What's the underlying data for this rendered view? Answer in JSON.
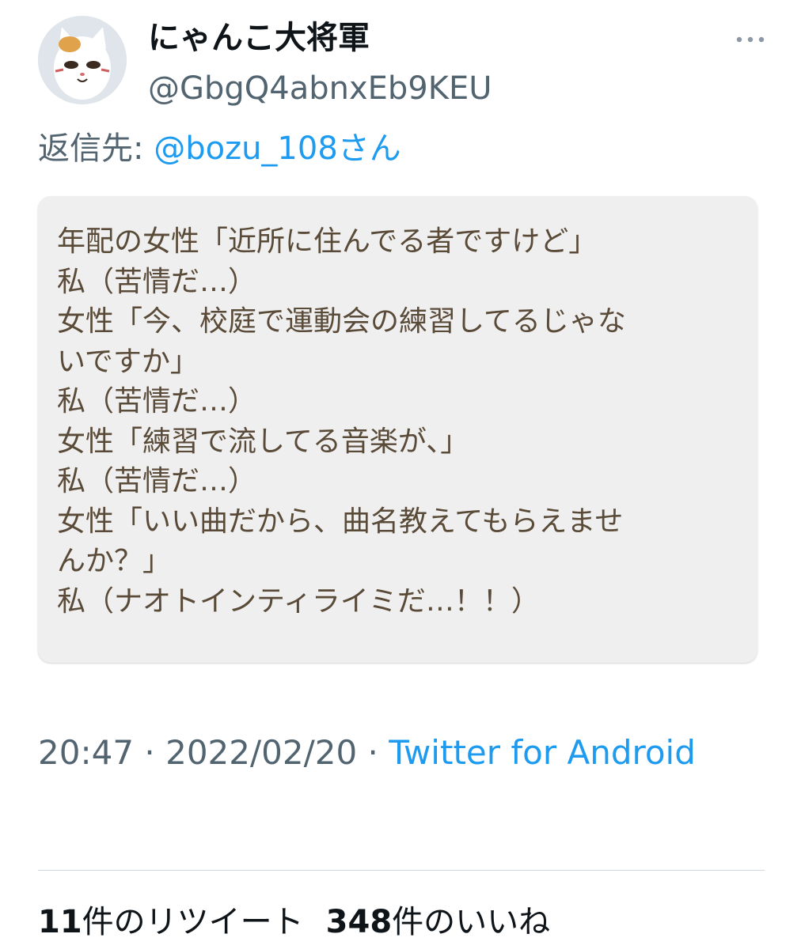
{
  "author": {
    "display_name": "にゃんこ大将軍",
    "handle": "@GbgQ4abnxEb9KEU",
    "avatar_icon": "cat-plush-avatar-icon"
  },
  "more_icon": "more-options-icon",
  "reply": {
    "prefix": "返信先: ",
    "mention": "@bozu_108さん"
  },
  "quote_lines": [
    "年配の女性「近所に住んでる者ですけど」",
    "私（苦情だ…）",
    "女性「今、校庭で運動会の練習してるじゃな",
    "いですか」",
    "私（苦情だ…）",
    "女性「練習で流してる音楽が、」",
    "私（苦情だ…）",
    "女性「いい曲だから、曲名教えてもらえませ",
    "んか？」",
    "私（ナオトインティライミだ…！！）"
  ],
  "meta": {
    "time": "20:47",
    "separator": " · ",
    "date": "2022/02/20",
    "source": "Twitter for Android"
  },
  "stats": {
    "retweets_count": "11",
    "retweets_label": "件のリツイート",
    "likes_count": "348",
    "likes_label": "件のいいね"
  },
  "colors": {
    "link": "#1d9bf0",
    "secondary_text": "#536471",
    "quote_bg": "#efefef",
    "quote_text": "#5a4a38"
  }
}
